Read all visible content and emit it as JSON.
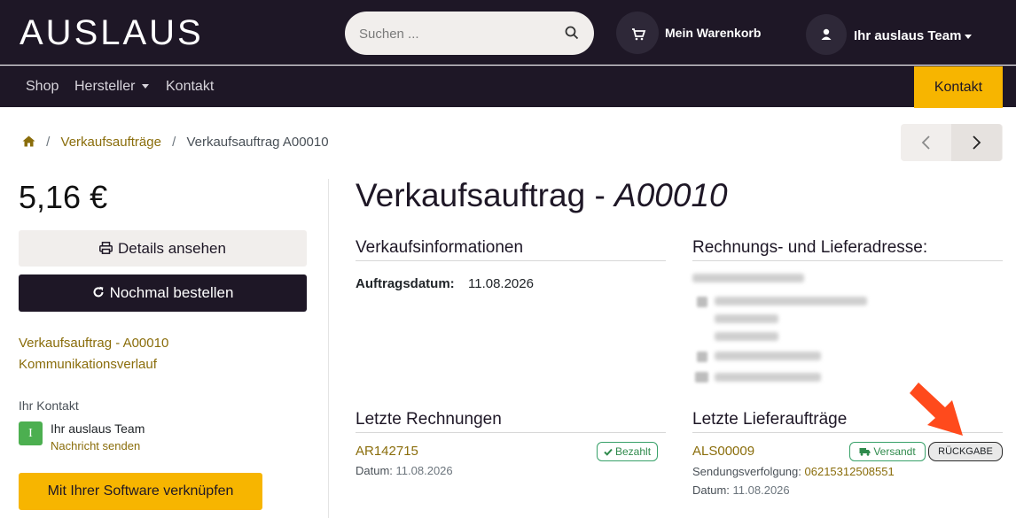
{
  "header": {
    "logo_text": "AUSLAUS",
    "search_placeholder": "Suchen ...",
    "cart_label": "Mein Warenkorb",
    "team_label": "Ihr auslaus Team"
  },
  "nav": {
    "items": [
      {
        "label": "Shop"
      },
      {
        "label": "Hersteller"
      },
      {
        "label": "Kontakt"
      }
    ],
    "cta_label": "Kontakt"
  },
  "breadcrumb": {
    "items": [
      "Verkaufsaufträge",
      "Verkaufsauftrag A00010"
    ]
  },
  "sidebar": {
    "price": "5,16 €",
    "details_label": "Details ansehen",
    "reorder_label": "Nochmal bestellen",
    "links": [
      "Verkaufsauftrag - A00010",
      "Kommunikationsverlauf"
    ],
    "contact_title": "Ihr Kontakt",
    "avatar_letter": "I",
    "contact_name": "Ihr auslaus Team",
    "contact_action": "Nachricht senden",
    "connect_label": "Mit Ihrer Software verknüpfen"
  },
  "main": {
    "title_prefix": "Verkaufsauftrag - ",
    "title_number": "A00010",
    "sales_info_heading": "Verkaufsinformationen",
    "order_date_label": "Auftragsdatum:",
    "order_date_value": "11.08.2026",
    "address_heading": "Rechnungs- und Lieferadresse:",
    "invoices_heading": "Letzte Rechnungen",
    "invoice": {
      "number": "AR142715",
      "status": "Bezahlt",
      "date_label": "Datum:",
      "date": "11.08.2026"
    },
    "deliveries_heading": "Letzte Lieferaufträge",
    "delivery": {
      "number": "ALS00009",
      "status": "Versandt",
      "return_label": "RÜCKGABE",
      "tracking_label": "Sendungsverfolgung:",
      "tracking_number": "06215312508551",
      "date_label": "Datum:",
      "date": "11.08.2026"
    }
  },
  "colors": {
    "dark": "#1e1726",
    "accent": "#f7b500",
    "link": "#8a6d0b",
    "success": "#38a169",
    "annotation_arrow": "#ff4a1c"
  }
}
